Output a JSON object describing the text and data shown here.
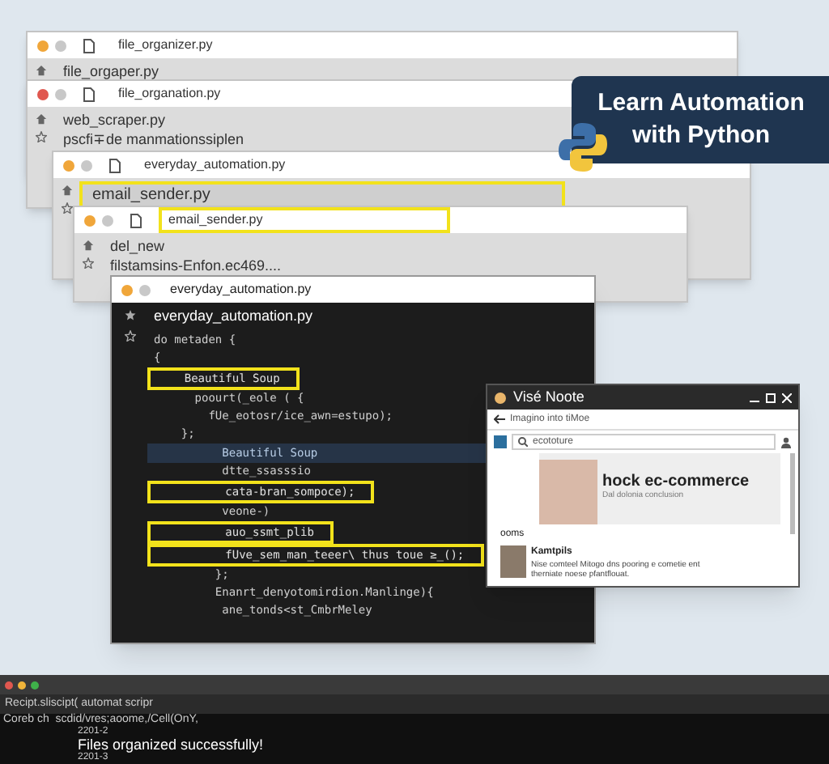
{
  "windows": [
    {
      "title": "file_organizer.py",
      "title_highlighted": false,
      "rows": [
        {
          "text": "file_orgaper.py",
          "highlighted": false
        }
      ]
    },
    {
      "title": "file_organation.py",
      "title_highlighted": false,
      "rows": [
        {
          "text": "web_scraper.py",
          "highlighted": false
        },
        {
          "text": "pscfi∓de manmationssiplen",
          "highlighted": false
        }
      ]
    },
    {
      "title": "everyday_automation.py",
      "title_highlighted": false,
      "rows": [
        {
          "text": "email_sender.py",
          "highlighted": true
        }
      ]
    },
    {
      "title": "email_sender.py",
      "title_highlighted": true,
      "rows": [
        {
          "text": "del_new",
          "highlighted": false
        },
        {
          "text": "filstamsins-Enfon.ec469....",
          "highlighted": false
        }
      ]
    }
  ],
  "editor": {
    "title": "everyday_automation.py",
    "file": "everyday_automation.py",
    "lines": [
      {
        "text": "do metaden {",
        "kind": "code"
      },
      {
        "text": "{",
        "kind": "code"
      },
      {
        "text": "    Beautiful Soup",
        "kind": "boxed"
      },
      {
        "text": "      poourt(_eole ( {",
        "kind": "code"
      },
      {
        "text": "        fUe_eotosr/ice_awn=estupo);",
        "kind": "code"
      },
      {
        "text": "    };",
        "kind": "code"
      },
      {
        "text": "          Beautiful Soup",
        "kind": "selected"
      },
      {
        "text": "          dtte_ssasssio",
        "kind": "code"
      },
      {
        "text": "          cata-bran_sompoce);",
        "kind": "boxed"
      },
      {
        "text": "          veone-)",
        "kind": "code"
      },
      {
        "text": "          auo_ssmt_plib",
        "kind": "boxed"
      },
      {
        "text": "          fUve_sem_man_teeer\\ thus toue ≥_();",
        "kind": "boxed"
      },
      {
        "text": "         };",
        "kind": "code"
      },
      {
        "text": "         Enanrt_denyotomirdion.Manlinge){",
        "kind": "code"
      },
      {
        "text": "          ane_tonds<st_CmbrMeley",
        "kind": "code"
      }
    ]
  },
  "banner": {
    "text": "Learn Automation with Python"
  },
  "browser": {
    "title": "Visé Noote",
    "address": "Imagino into tiMoe",
    "search": "ecototure",
    "hero_title": "hock ec-commerce",
    "hero_subtitle": "Dal dolonia conclusion",
    "section": "ooms",
    "item_title": "Kamtpils",
    "item_text": "Nise comteel Mitogo dns pooring e cometie ent therniate noese pfantflouat."
  },
  "terminal": {
    "tab": "Recipt.sliscipt( automat scripr",
    "lines": [
      {
        "text": "Coreb ch  scdid/vres;aoome,/Cell(OnY,",
        "kind": "path"
      },
      {
        "text": "2201-2",
        "kind": "small"
      },
      {
        "text": "Files organized successfully!",
        "kind": "output"
      },
      {
        "text": "2201-3",
        "kind": "small"
      }
    ]
  }
}
